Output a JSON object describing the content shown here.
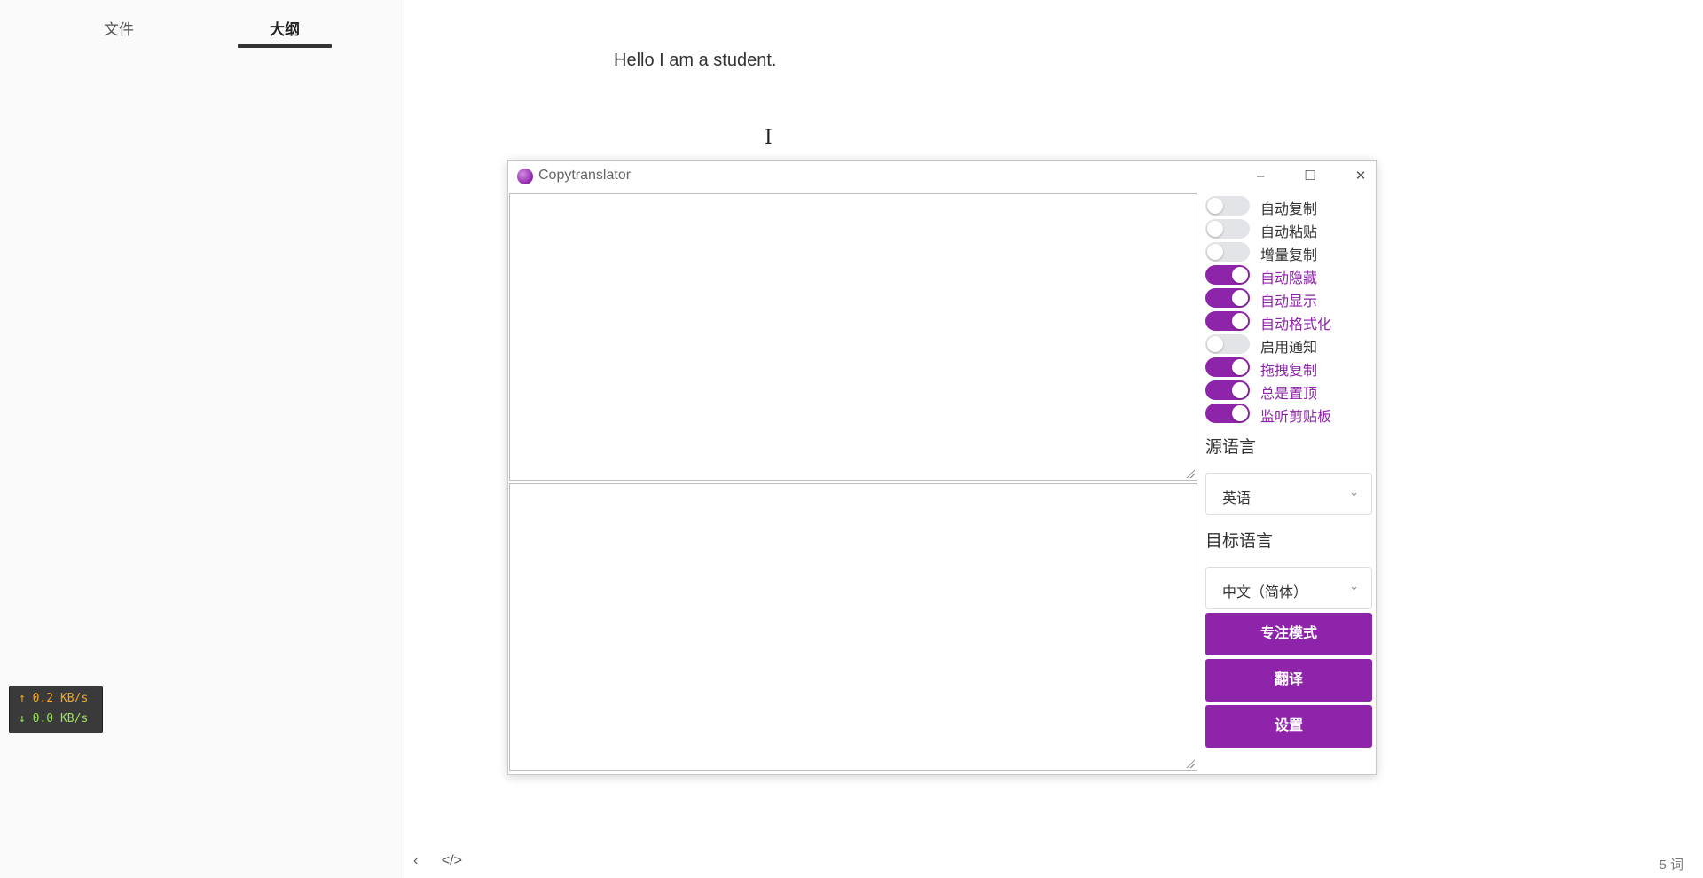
{
  "sidebar": {
    "tabs": [
      {
        "label": "文件",
        "active": false
      },
      {
        "label": "大纲",
        "active": true
      }
    ]
  },
  "netspeed": {
    "up": "↑ 0.2 KB/s",
    "down": "↓ 0.0 KB/s"
  },
  "editor": {
    "text": "Hello I am a student.",
    "word_count": "5 词",
    "cursor_glyph": "I",
    "back_icon_glyph": "‹",
    "source_icon_glyph": "</>"
  },
  "copytranslator": {
    "title": "Copytranslator",
    "window_buttons": {
      "minimize": "–",
      "maximize": "☐",
      "close": "✕"
    },
    "toggles": [
      {
        "label": "自动复制",
        "on": false
      },
      {
        "label": "自动粘贴",
        "on": false
      },
      {
        "label": "增量复制",
        "on": false
      },
      {
        "label": "自动隐藏",
        "on": true
      },
      {
        "label": "自动显示",
        "on": true
      },
      {
        "label": "自动格式化",
        "on": true
      },
      {
        "label": "启用通知",
        "on": false
      },
      {
        "label": "拖拽复制",
        "on": true
      },
      {
        "label": "总是置顶",
        "on": true
      },
      {
        "label": "监听剪贴板",
        "on": true
      }
    ],
    "source_lang_label": "源语言",
    "source_lang_value": "英语",
    "target_lang_label": "目标语言",
    "target_lang_value": "中文（简体）",
    "buttons": {
      "focus": "专注模式",
      "translate": "翻译",
      "settings": "设置"
    },
    "accent_color": "#8e24aa"
  }
}
